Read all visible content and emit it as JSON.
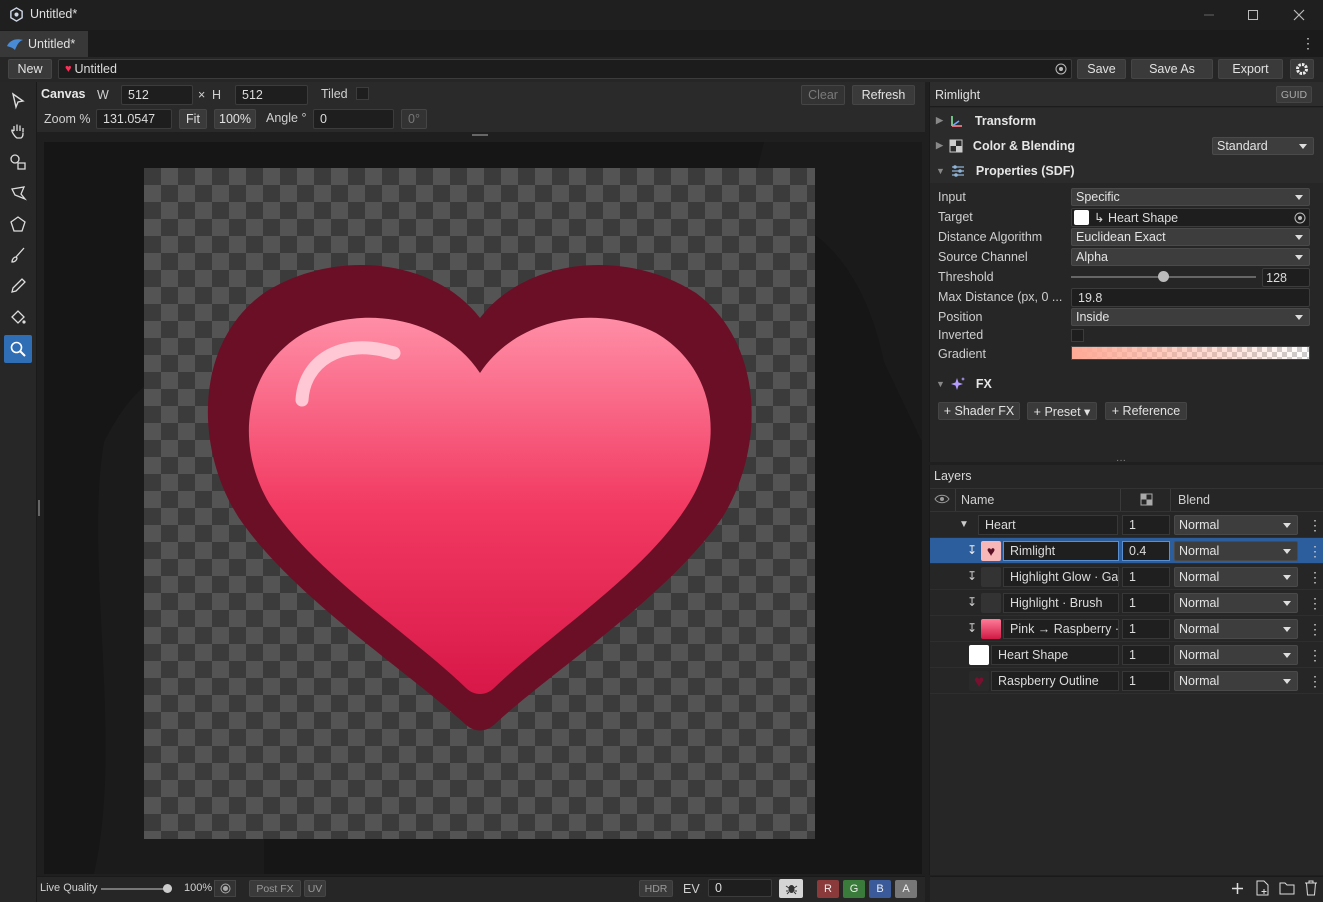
{
  "window": {
    "title": "Untitled*"
  },
  "tab": {
    "label": "Untitled*"
  },
  "docbar": {
    "new_label": "New",
    "doc_name": "Untitled",
    "save_label": "Save",
    "save_as_label": "Save As",
    "export_label": "Export"
  },
  "canvas": {
    "label": "Canvas",
    "w_label": "W",
    "width": "512",
    "x_sep": "×",
    "h_label": "H",
    "height": "512",
    "tiled_label": "Tiled",
    "clear_label": "Clear",
    "refresh_label": "Refresh",
    "zoom_label": "Zoom %",
    "zoom": "131.0547",
    "fit_label": "Fit",
    "hundred_label": "100%",
    "angle_label": "Angle °",
    "angle": "0",
    "angle_reset": "0°"
  },
  "bottom": {
    "live_quality_label": "Live Quality",
    "quality": "100%",
    "quality_fraction": 1.0,
    "post_fx": "Post FX",
    "uv": "UV",
    "hdr": "HDR",
    "ev_label": "EV",
    "ev": "0",
    "r": "R",
    "g": "G",
    "b": "B",
    "a": "A"
  },
  "inspector": {
    "title": "Rimlight",
    "guid_label": "GUID",
    "sections": {
      "transform": "Transform",
      "color_blending": "Color & Blending",
      "color_blending_mode": "Standard",
      "properties": "Properties (SDF)",
      "fx": "FX"
    },
    "props": {
      "input_label": "Input",
      "input": "Specific",
      "target_label": "Target",
      "target": "↳ Heart Shape",
      "distance_label": "Distance Algorithm",
      "distance": "Euclidean Exact",
      "channel_label": "Source Channel",
      "channel": "Alpha",
      "threshold_label": "Threshold",
      "threshold": "128",
      "threshold_fraction": 0.5,
      "maxdist_label": "Max Distance (px, 0 ...",
      "maxdist": "19.8",
      "position_label": "Position",
      "position": "Inside",
      "inverted_label": "Inverted",
      "gradient_label": "Gradient"
    },
    "fx_buttons": [
      "+ Shader FX",
      "+ Preset ▾",
      "+ Reference"
    ]
  },
  "layers": {
    "title": "Layers",
    "col_name": "Name",
    "col_blend": "Blend",
    "rows": [
      {
        "name": "Heart",
        "opacity": "1",
        "blend": "Normal"
      },
      {
        "name": "Rimlight",
        "opacity": "0.4",
        "blend": "Normal"
      },
      {
        "name": "Highlight Glow · Ga",
        "opacity": "1",
        "blend": "Normal"
      },
      {
        "name": "Highlight · Brush",
        "opacity": "1",
        "blend": "Normal"
      },
      {
        "name": "Pink → Raspberry ·",
        "opacity": "1",
        "blend": "Normal"
      },
      {
        "name": "Heart Shape",
        "opacity": "1",
        "blend": "Normal"
      },
      {
        "name": "Raspberry Outline",
        "opacity": "1",
        "blend": "Normal"
      }
    ]
  },
  "colors": {
    "accent": "#2f6db5",
    "heart_outline": "#6b0f26",
    "heart_fill": "#ff5a7a"
  }
}
